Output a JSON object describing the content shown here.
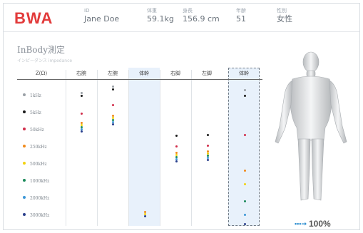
{
  "brand": {
    "logo": "BWA",
    "accent": "#e23b3b"
  },
  "header_fields": [
    {
      "label": "ID",
      "value": "Jane Doe"
    },
    {
      "label": "体重",
      "value": "59.1kg"
    },
    {
      "label": "身長",
      "value": "156.9 cm"
    },
    {
      "label": "年齢",
      "value": "51"
    },
    {
      "label": "性別",
      "value": "女性"
    }
  ],
  "section": {
    "title": "InBody測定",
    "subtitle": "インピーダンス impedance"
  },
  "table": {
    "corner_label": "Z(Ω)",
    "columns": [
      "右腕",
      "左腕",
      "体幹",
      "右脚",
      "左脚",
      "体幹"
    ],
    "frequencies": [
      {
        "label": "1kHz",
        "color": "#9aa0a6"
      },
      {
        "label": "5kHz",
        "color": "#1a1a1a"
      },
      {
        "label": "50kHz",
        "color": "#d12d4a"
      },
      {
        "label": "250kHz",
        "color": "#f08a1c"
      },
      {
        "label": "500kHz",
        "color": "#f2d20f"
      },
      {
        "label": "1000kHz",
        "color": "#1b8a5a"
      },
      {
        "label": "2000kHz",
        "color": "#3b96d6"
      },
      {
        "label": "3000kHz",
        "color": "#2b3f8c"
      }
    ],
    "measurement_progress": {
      "label": "100%",
      "value": 1.0,
      "dot_color": "#2f8fd0"
    }
  }
}
